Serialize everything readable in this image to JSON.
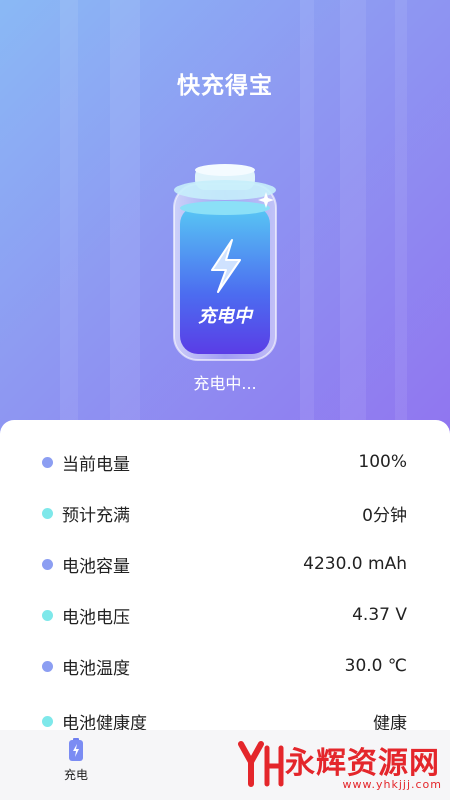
{
  "app": {
    "title": "快充得宝"
  },
  "battery": {
    "badge_text": "充电中",
    "status_text": "充电中..."
  },
  "info_rows": [
    {
      "label": "当前电量",
      "value": "100%",
      "dot_color": "#8c9ef2"
    },
    {
      "label": "预计充满",
      "value": "0分钟",
      "dot_color": "#7ee8ea"
    },
    {
      "label": "电池容量",
      "value": "4230.0 mAh",
      "dot_color": "#8c9ef2"
    },
    {
      "label": "电池电压",
      "value": "4.37 V",
      "dot_color": "#7ee8ea"
    },
    {
      "label": "电池温度",
      "value": "30.0 ℃",
      "dot_color": "#8c9ef2"
    },
    {
      "label": "电池健康度",
      "value": "健康",
      "dot_color": "#7ee8ea"
    }
  ],
  "tabbar": {
    "tabs": [
      {
        "label": "充电",
        "icon": "battery-icon",
        "active": true
      }
    ]
  },
  "watermark": {
    "text": "永辉资源网",
    "url": "www.yhkjjj.com"
  },
  "colors": {
    "accent": "#8e98f2",
    "watermark_red": "#e4262b"
  }
}
